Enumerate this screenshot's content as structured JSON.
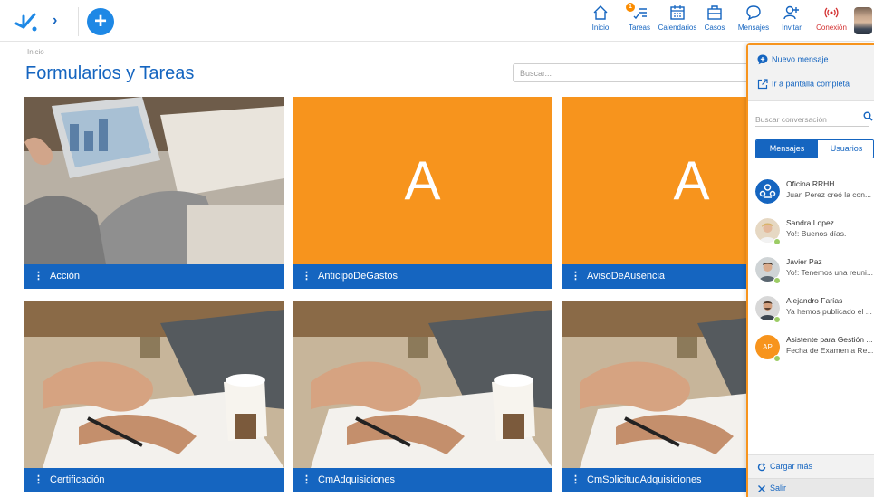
{
  "topbar": {
    "nav": [
      {
        "label": "Inicio",
        "icon": "home-icon"
      },
      {
        "label": "Tareas",
        "icon": "tasks-icon",
        "badge": "1"
      },
      {
        "label": "Calendarios",
        "icon": "calendar-icon"
      },
      {
        "label": "Casos",
        "icon": "briefcase-icon"
      },
      {
        "label": "Mensajes",
        "icon": "message-icon"
      },
      {
        "label": "Invitar",
        "icon": "invite-icon"
      },
      {
        "label": "Conexión",
        "icon": "connection-icon"
      }
    ],
    "accent": "#1565c0",
    "connection_color": "#d32f2f"
  },
  "breadcrumb": "Inicio",
  "page_title": "Formularios y Tareas",
  "search": {
    "placeholder": "Buscar..."
  },
  "cards": [
    {
      "label": "Acción",
      "type": "photo-office"
    },
    {
      "label": "AnticipoDeGastos",
      "type": "letter",
      "letter": "A"
    },
    {
      "label": "AvisoDeAusencia",
      "type": "letter",
      "letter": "A"
    },
    {
      "label": "Certificación",
      "type": "photo-writing"
    },
    {
      "label": "CmAdquisiciones",
      "type": "photo-writing"
    },
    {
      "label": "CmSolicitudAdquisiciones",
      "type": "photo-writing"
    }
  ],
  "card_colors": {
    "footer": "#1565c0",
    "letter_bg": "#f7941d"
  },
  "panel": {
    "new_message": "Nuevo mensaje",
    "full_screen": "Ir a pantalla completa",
    "search_placeholder": "Buscar conversación",
    "tabs": [
      "Mensajes",
      "Usuarios"
    ],
    "conversations": [
      {
        "name": "Oficina RRHH",
        "preview": "Juan Perez creó la con...",
        "avatar": "group-icon"
      },
      {
        "name": "Sandra Lopez",
        "preview": "Yo!: Buenos días.",
        "avatar": "user-photo"
      },
      {
        "name": "Javier Paz",
        "preview": "Yo!: Tenemos una reuni...",
        "avatar": "user-photo"
      },
      {
        "name": "Alejandro Farías",
        "preview": "Ya hemos publicado el ...",
        "avatar": "user-photo"
      },
      {
        "name": "Asistente para Gestión ...",
        "preview": "Fecha de Examen a Re...",
        "avatar_initials": "AP"
      }
    ],
    "load_more": "Cargar más",
    "exit": "Salir",
    "border_color": "#f7941d"
  }
}
